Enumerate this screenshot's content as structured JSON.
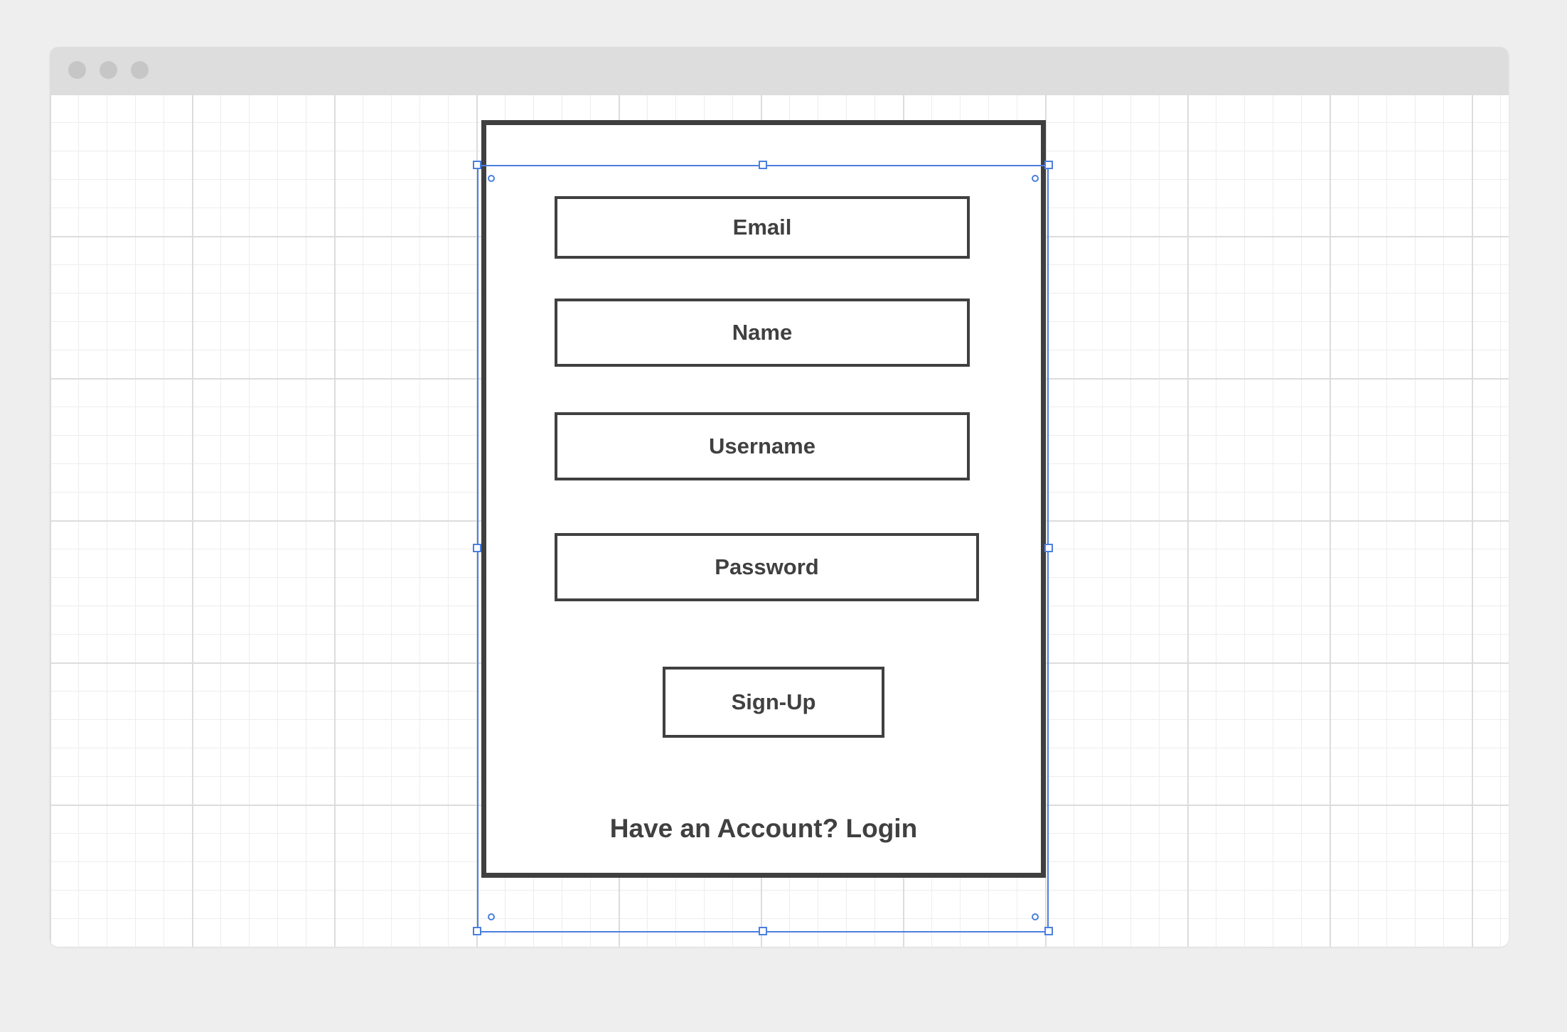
{
  "form": {
    "email_label": "Email",
    "name_label": "Name",
    "username_label": "Username",
    "password_label": "Password",
    "signup_label": "Sign-Up",
    "login_prompt": "Have an Account? Login"
  },
  "colors": {
    "page_background": "#eeeeee",
    "titlebar": "#dddddd",
    "window_dots": "#c6c6c6",
    "outline": "#404040",
    "selection": "#4a7fe0"
  },
  "icons": {
    "window_controls": [
      "window-dot-icon",
      "window-dot-icon",
      "window-dot-icon"
    ],
    "selection_handles": "resize-handle-icon"
  }
}
